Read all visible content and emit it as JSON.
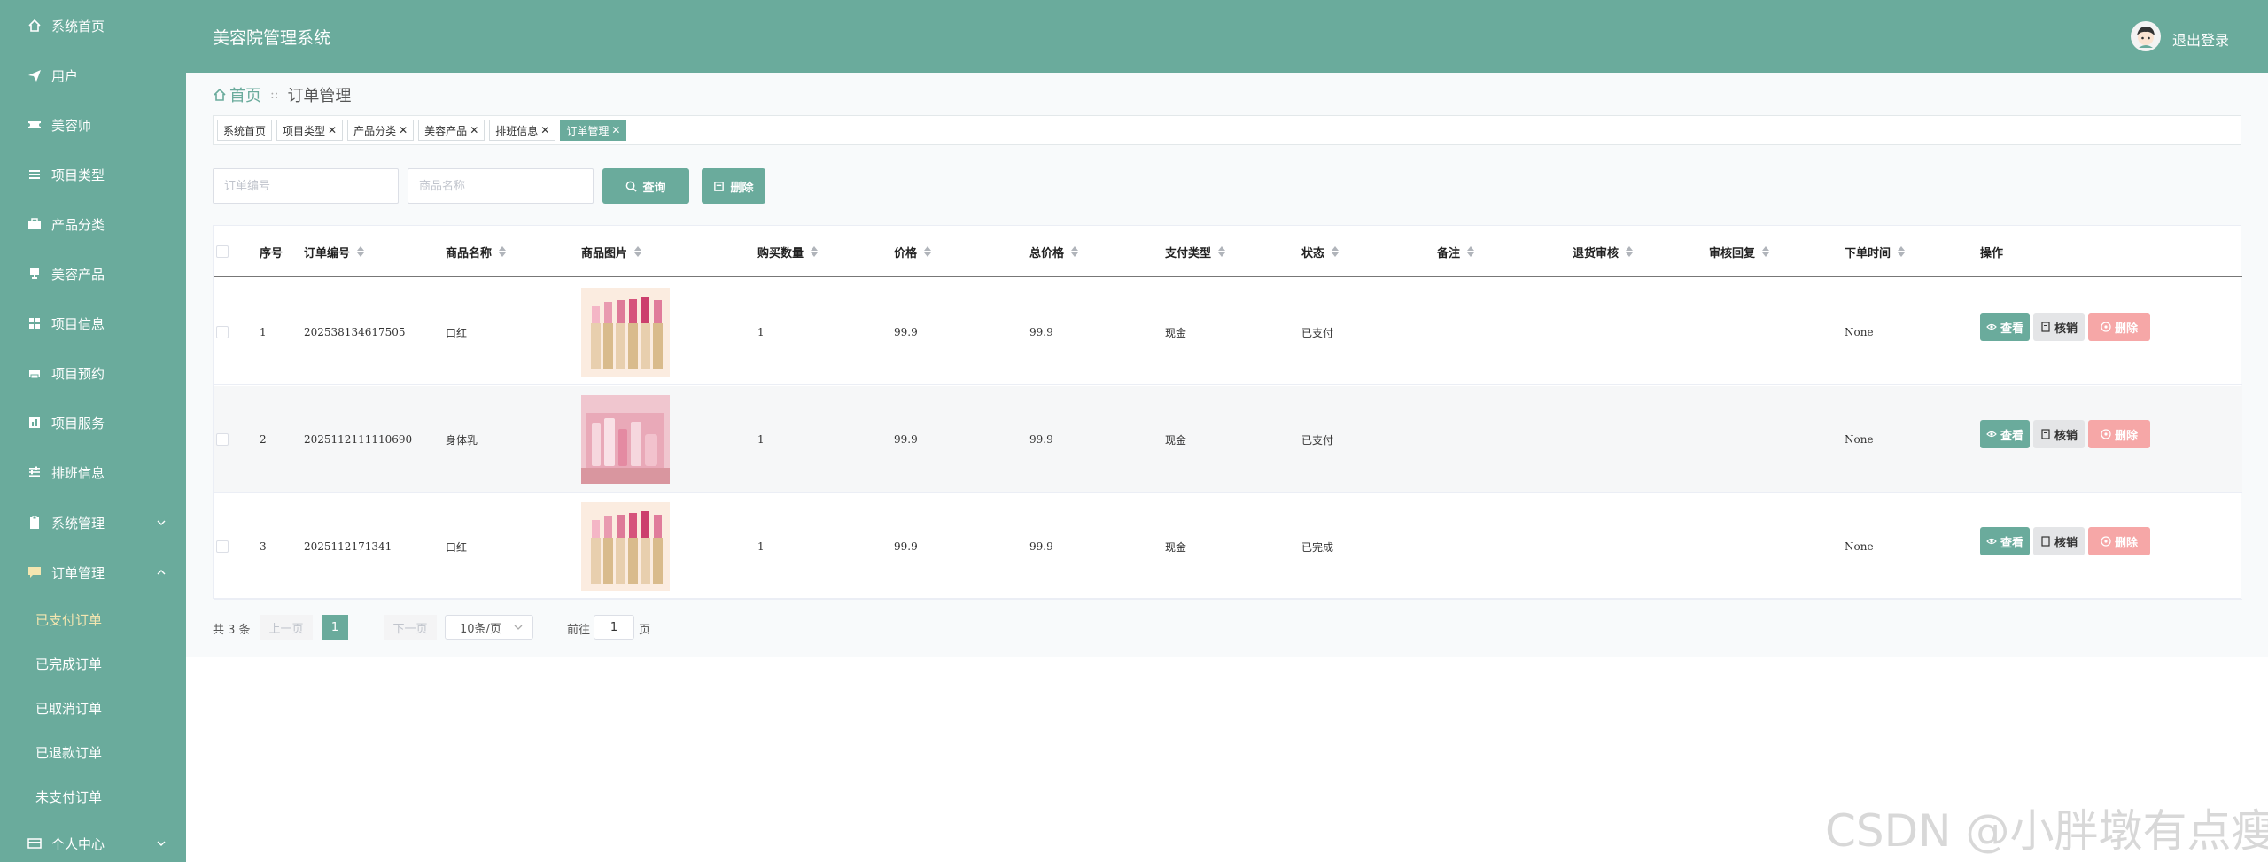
{
  "header": {
    "title": "美容院管理系统",
    "logout": "退出登录"
  },
  "sidebar": {
    "items": [
      {
        "label": "系统首页",
        "icon": "home-icon"
      },
      {
        "label": "用户",
        "icon": "send-icon"
      },
      {
        "label": "美容师",
        "icon": "ticket-icon"
      },
      {
        "label": "项目类型",
        "icon": "list-icon"
      },
      {
        "label": "产品分类",
        "icon": "briefcase-icon"
      },
      {
        "label": "美容产品",
        "icon": "trophy-icon"
      },
      {
        "label": "项目信息",
        "icon": "grid-icon"
      },
      {
        "label": "项目预约",
        "icon": "printer-icon"
      },
      {
        "label": "项目服务",
        "icon": "chart-icon"
      },
      {
        "label": "排班信息",
        "icon": "sliders-icon"
      },
      {
        "label": "系统管理",
        "icon": "clipboard-icon"
      },
      {
        "label": "订单管理",
        "icon": "message-icon"
      },
      {
        "label": "个人中心",
        "icon": "card-icon"
      }
    ],
    "sub_items": [
      {
        "label": "已支付订单"
      },
      {
        "label": "已完成订单"
      },
      {
        "label": "已取消订单"
      },
      {
        "label": "已退款订单"
      },
      {
        "label": "未支付订单"
      }
    ]
  },
  "breadcrumb": {
    "home": "首页",
    "separator": "::",
    "current": "订单管理"
  },
  "tags": [
    {
      "label": "系统首页"
    },
    {
      "label": "项目类型"
    },
    {
      "label": "产品分类"
    },
    {
      "label": "美容产品"
    },
    {
      "label": "排班信息"
    },
    {
      "label": "订单管理"
    }
  ],
  "tag_close": "✕",
  "search": {
    "order_placeholder": "订单编号",
    "product_placeholder": "商品名称",
    "query_label": "查询",
    "delete_label": "删除"
  },
  "table": {
    "columns": [
      "序号",
      "订单编号",
      "商品名称",
      "商品图片",
      "购买数量",
      "价格",
      "总价格",
      "支付类型",
      "状态",
      "备注",
      "退货审核",
      "审核回复",
      "下单时间",
      "操作"
    ],
    "rows": [
      {
        "index": "1",
        "order_no": "202538134617505",
        "product": "口红",
        "image": "lipstick-image",
        "qty": "1",
        "price": "99.9",
        "total": "99.9",
        "pay_type": "现金",
        "status": "已支付",
        "remark": "",
        "return_review": "",
        "review_reply": "",
        "order_time": "None"
      },
      {
        "index": "2",
        "order_no": "2025112111110690",
        "product": "身体乳",
        "image": "body-lotion-image",
        "qty": "1",
        "price": "99.9",
        "total": "99.9",
        "pay_type": "现金",
        "status": "已支付",
        "remark": "",
        "return_review": "",
        "review_reply": "",
        "order_time": "None"
      },
      {
        "index": "3",
        "order_no": "2025112171341",
        "product": "口红",
        "image": "lipstick-image",
        "qty": "1",
        "price": "99.9",
        "total": "99.9",
        "pay_type": "现金",
        "status": "已完成",
        "remark": "",
        "return_review": "",
        "review_reply": "",
        "order_time": "None"
      }
    ],
    "actions": {
      "view": "查看",
      "cancel": "核销",
      "delete": "删除"
    }
  },
  "pagination": {
    "total": "共 3 条",
    "prev": "上一页",
    "current": "1",
    "next": "下一页",
    "page_size": "10条/页",
    "goto": "前往",
    "goto_value": "1",
    "page_suffix": "页"
  },
  "watermark": "CSDN @小胖墩有点瘦",
  "colors": {
    "primary": "#6aab9c",
    "danger_light": "#f6a7a7"
  }
}
